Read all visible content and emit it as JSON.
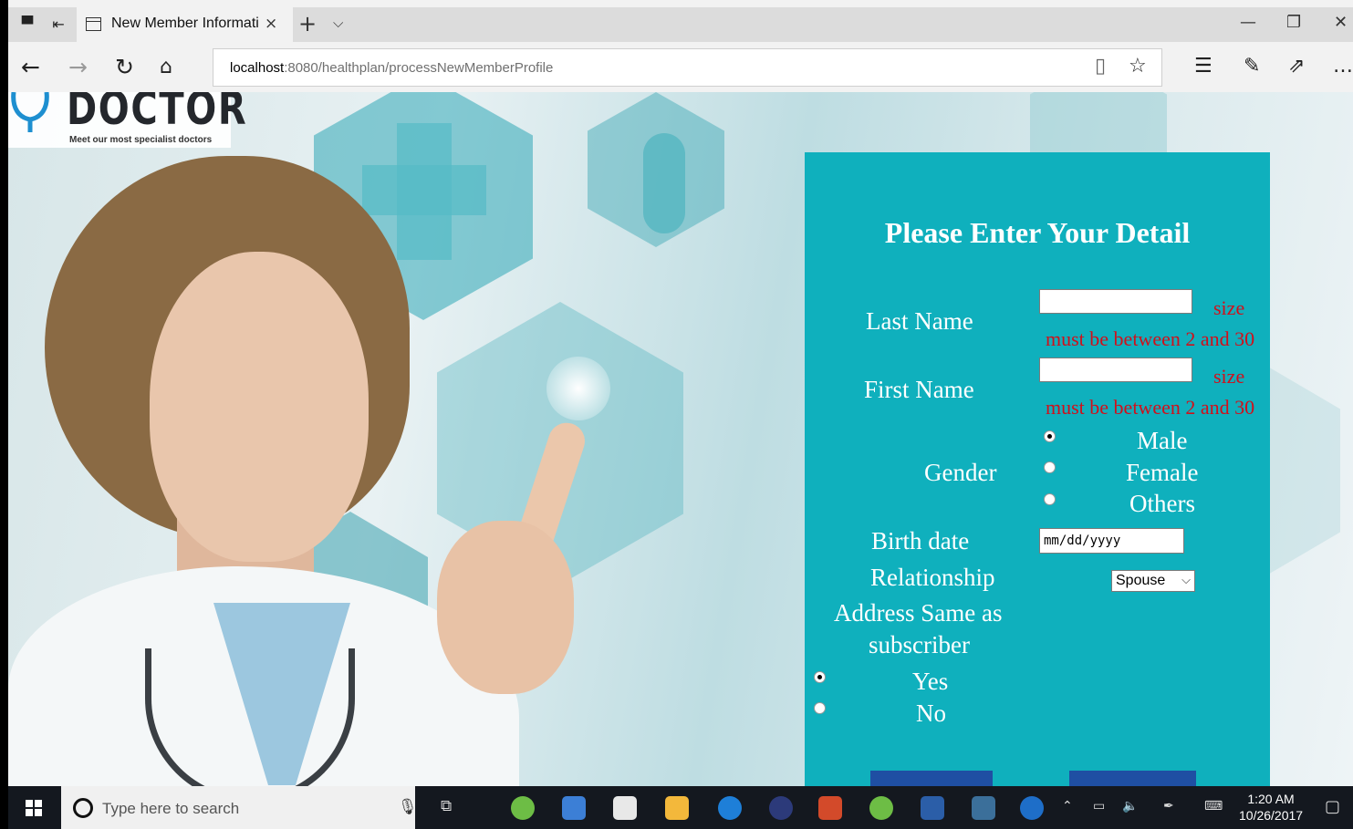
{
  "browser": {
    "tab_title": "New Member Informati",
    "tab_close": "×",
    "new_tab": "+",
    "tab_dropdown": "⌵",
    "url_host": "localhost",
    "url_path": ":8080/healthplan/processNewMemberProfile",
    "icons": [
      "tab-preview-icon",
      "tab-aside-icon",
      "back-icon",
      "forward-icon",
      "refresh-icon",
      "home-icon",
      "reading-view-icon",
      "favorite-star-icon",
      "favorites-hub-icon",
      "web-note-icon",
      "share-icon",
      "more-icon"
    ]
  },
  "logo": {
    "name": "DOCTOR",
    "tagline": "Meet our most specialist doctors"
  },
  "form": {
    "title": "Please Enter Your Detail",
    "last_name_label": "Last Name",
    "last_name_value": "",
    "last_name_error_1": "size",
    "last_name_error_2": "must be between 2 and 30",
    "first_name_label": "First Name",
    "first_name_value": "",
    "first_name_error_1": "size",
    "first_name_error_2": "must be between 2 and 30",
    "gender_label": "Gender",
    "gender_options": [
      "Male",
      "Female",
      "Others"
    ],
    "gender_selected": "Male",
    "birth_date_label": "Birth date",
    "birth_date_placeholder": "mm/dd/yyyy",
    "relationship_label": "Relationship",
    "relationship_selected": "Spouse",
    "address_label_1": "Address Same as",
    "address_label_2": "subscriber",
    "address_options": [
      "Yes",
      "No"
    ],
    "address_selected": "Yes"
  },
  "taskbar": {
    "search_placeholder": "Type here to search",
    "time": "1:20 AM",
    "date": "10/26/2017"
  },
  "colors": {
    "panel": "#0fb0bd",
    "error": "#d10f1a",
    "button": "#1f4fa3",
    "taskbar": "#14181f"
  }
}
